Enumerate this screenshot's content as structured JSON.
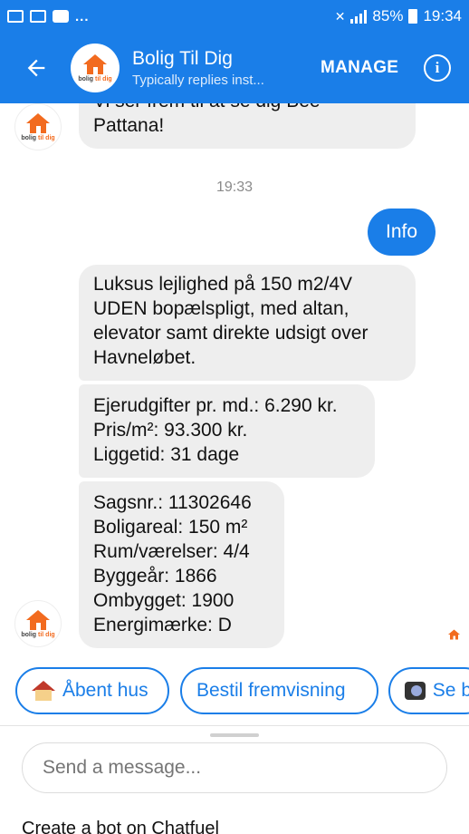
{
  "status_bar": {
    "battery": "85%",
    "time": "19:34",
    "more": "..."
  },
  "header": {
    "name": "Bolig Til Dig",
    "subtitle": "Typically replies inst...",
    "manage_label": "MANAGE",
    "info_glyph": "i",
    "logo_text_main": "bolig",
    "logo_text_accent": "til dig"
  },
  "chat": {
    "partial_message": [
      "Vi ser frem til at se dig Bee",
      "Pattana!"
    ],
    "timestamp": "19:33",
    "outgoing": "Info",
    "message_1": [
      "Luksus lejlighed på 150 m2/4V",
      "UDEN bopælspligt, med altan,",
      "elevator samt direkte udsigt over",
      "Havneløbet."
    ],
    "message_2": [
      "Ejerudgifter pr. md.: 6.290 kr.",
      "Pris/m²: 93.300 kr.",
      "Liggetid: 31 dage"
    ],
    "message_3": [
      "Sagsnr.: 11302646",
      "Boligareal: 150 m²",
      "Rum/værelser: 4/4",
      "Byggeår: 1866",
      "Ombygget: 1900",
      "Energimærke: D"
    ]
  },
  "quick_replies": [
    {
      "label": "Åbent hus",
      "icon": "house-emoji"
    },
    {
      "label": "Bestil fremvisning",
      "icon": ""
    },
    {
      "label": "Se b",
      "icon": "camera-emoji"
    }
  ],
  "composer": {
    "placeholder": "Send a message...",
    "footer": "Create a bot on Chatfuel"
  },
  "colors": {
    "accent": "#1a7ee8",
    "bubble": "#eeeeee",
    "logo": "#f26b1f"
  }
}
